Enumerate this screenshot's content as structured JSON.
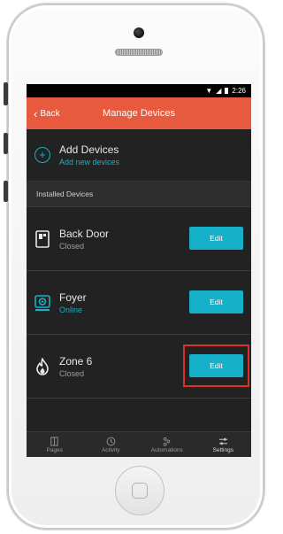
{
  "status": {
    "time": "2:26"
  },
  "header": {
    "back_label": "Back",
    "title": "Manage Devices"
  },
  "add_devices": {
    "title": "Add Devices",
    "subtitle": "Add new devices"
  },
  "section_label": "Installed Devices",
  "devices": [
    {
      "name": "Back Door",
      "status": "Closed",
      "icon": "door-sensor-icon",
      "edit_label": "Edit"
    },
    {
      "name": "Foyer",
      "status": "Online",
      "icon": "camera-icon",
      "edit_label": "Edit"
    },
    {
      "name": "Zone 6",
      "status": "Closed",
      "icon": "flame-icon",
      "edit_label": "Edit"
    }
  ],
  "tabs": [
    {
      "label": "Pages",
      "icon": "pages-icon"
    },
    {
      "label": "Activity",
      "icon": "clock-icon"
    },
    {
      "label": "Automations",
      "icon": "automation-icon"
    },
    {
      "label": "Settings",
      "icon": "sliders-icon",
      "active": true
    }
  ],
  "colors": {
    "accent": "#16b0c8",
    "header": "#e85a3d",
    "highlight": "#d9322b"
  }
}
